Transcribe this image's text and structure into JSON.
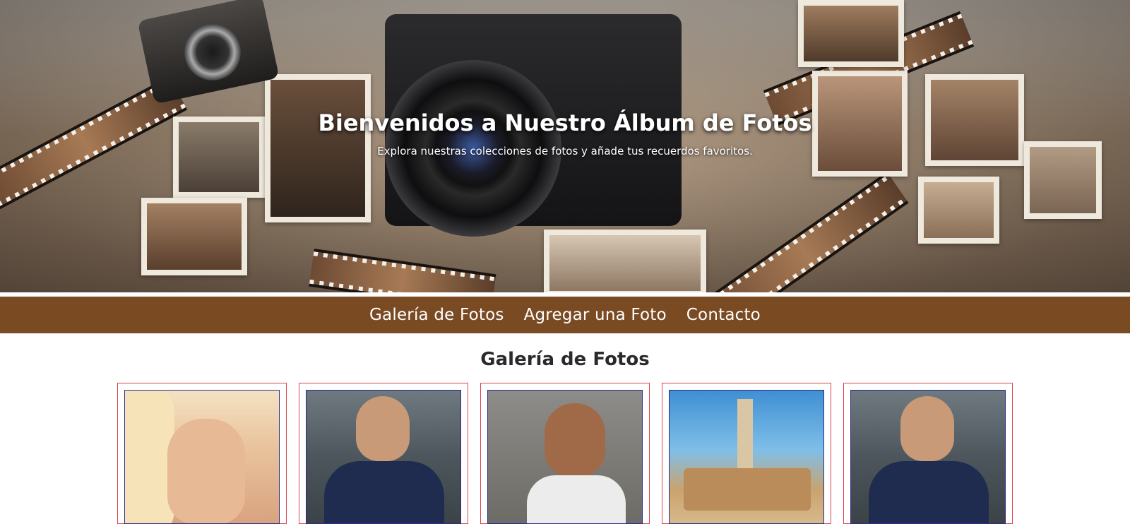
{
  "hero": {
    "title": "Bienvenidos a Nuestro Álbum de Fotos",
    "subtitle": "Explora nuestras colecciones de fotos y añade tus recuerdos favoritos."
  },
  "nav": {
    "items": [
      {
        "label": "Galería de Fotos"
      },
      {
        "label": "Agregar una Foto"
      },
      {
        "label": "Contacto"
      }
    ],
    "background_color": "#7a4a22"
  },
  "gallery": {
    "title": "Galería de Fotos",
    "border_color": "#d9434e",
    "photos": [
      {
        "subject": "woman-portrait"
      },
      {
        "subject": "man-argentina-shirt"
      },
      {
        "subject": "man-flexing"
      },
      {
        "subject": "monument-tower-city"
      },
      {
        "subject": "man-argentina-shirt"
      }
    ]
  }
}
